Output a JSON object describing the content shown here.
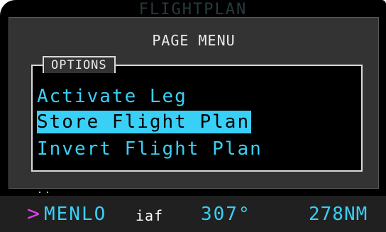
{
  "background_page": {
    "title": "FLIGHTPLAN"
  },
  "page_menu": {
    "title": "PAGE MENU",
    "options_label": "OPTIONS",
    "items": [
      {
        "label": "Activate Leg",
        "selected": false
      },
      {
        "label": "Store Flight Plan",
        "selected": true
      },
      {
        "label": "Invert Flight Plan",
        "selected": false
      }
    ]
  },
  "active_leg": {
    "indicator": ">",
    "waypoint": "MENLO",
    "waypoint_type": "iaf",
    "course": "307°",
    "distance": "278NM"
  },
  "colors": {
    "screen_background": "#000000",
    "menu_background": "#333333",
    "cyan_text": "#38d0f6",
    "selection_highlight": "#38d0f6",
    "active_leg_arrow": "#e040e8",
    "white_text": "#ececec"
  }
}
